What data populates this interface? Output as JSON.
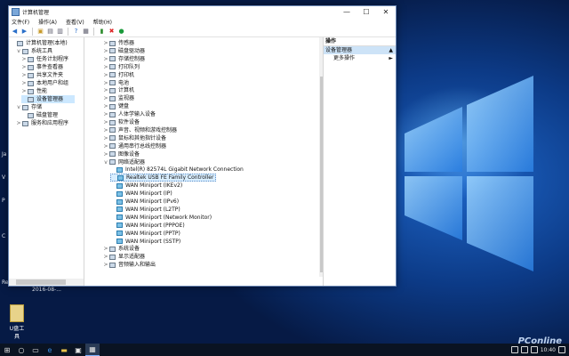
{
  "window": {
    "title": "计算机管理",
    "controls": {
      "minimize": "—",
      "maximize": "☐",
      "close": "✕"
    },
    "menu": [
      "文件(F)",
      "操作(A)",
      "查看(V)",
      "帮助(H)"
    ]
  },
  "left_tree": {
    "items": [
      {
        "label": "计算机管理(本地)",
        "depth": 0,
        "chev": ""
      },
      {
        "label": "系统工具",
        "depth": 1,
        "chev": "v"
      },
      {
        "label": "任务计划程序",
        "depth": 2,
        "chev": ">"
      },
      {
        "label": "事件查看器",
        "depth": 2,
        "chev": ">"
      },
      {
        "label": "共享文件夹",
        "depth": 2,
        "chev": ">"
      },
      {
        "label": "本地用户和组",
        "depth": 2,
        "chev": ">"
      },
      {
        "label": "性能",
        "depth": 2,
        "chev": ">"
      },
      {
        "label": "设备管理器",
        "depth": 2,
        "chev": "",
        "selected": true
      },
      {
        "label": "存储",
        "depth": 1,
        "chev": "v"
      },
      {
        "label": "磁盘管理",
        "depth": 2,
        "chev": ""
      },
      {
        "label": "服务和应用程序",
        "depth": 1,
        "chev": ">"
      }
    ]
  },
  "device_tree": {
    "items": [
      {
        "label": "传感器",
        "depth": 1,
        "chev": ">"
      },
      {
        "label": "磁盘驱动器",
        "depth": 1,
        "chev": ">"
      },
      {
        "label": "存储控制器",
        "depth": 1,
        "chev": ">"
      },
      {
        "label": "打印队列",
        "depth": 1,
        "chev": ">"
      },
      {
        "label": "打印机",
        "depth": 1,
        "chev": ">"
      },
      {
        "label": "电池",
        "depth": 1,
        "chev": ">"
      },
      {
        "label": "计算机",
        "depth": 1,
        "chev": ">"
      },
      {
        "label": "监视器",
        "depth": 1,
        "chev": ">"
      },
      {
        "label": "键盘",
        "depth": 1,
        "chev": ">"
      },
      {
        "label": "人体学输入设备",
        "depth": 1,
        "chev": ">"
      },
      {
        "label": "软件设备",
        "depth": 1,
        "chev": ">"
      },
      {
        "label": "声音、视频和游戏控制器",
        "depth": 1,
        "chev": ">"
      },
      {
        "label": "鼠标和其他指针设备",
        "depth": 1,
        "chev": ">"
      },
      {
        "label": "通用串行总线控制器",
        "depth": 1,
        "chev": ">"
      },
      {
        "label": "图像设备",
        "depth": 1,
        "chev": ">"
      },
      {
        "label": "网络适配器",
        "depth": 1,
        "chev": "v"
      },
      {
        "label": "Intel(R) 82574L Gigabit Network Connection",
        "depth": 2,
        "chev": "",
        "net": true
      },
      {
        "label": "Realtek USB FE Family Controller",
        "depth": 2,
        "chev": "",
        "net": true,
        "selected": true
      },
      {
        "label": "WAN Miniport (IKEv2)",
        "depth": 2,
        "chev": "",
        "net": true
      },
      {
        "label": "WAN Miniport (IP)",
        "depth": 2,
        "chev": "",
        "net": true
      },
      {
        "label": "WAN Miniport (IPv6)",
        "depth": 2,
        "chev": "",
        "net": true
      },
      {
        "label": "WAN Miniport (L2TP)",
        "depth": 2,
        "chev": "",
        "net": true
      },
      {
        "label": "WAN Miniport (Network Monitor)",
        "depth": 2,
        "chev": "",
        "net": true
      },
      {
        "label": "WAN Miniport (PPPOE)",
        "depth": 2,
        "chev": "",
        "net": true
      },
      {
        "label": "WAN Miniport (PPTP)",
        "depth": 2,
        "chev": "",
        "net": true
      },
      {
        "label": "WAN Miniport (SSTP)",
        "depth": 2,
        "chev": "",
        "net": true
      },
      {
        "label": "系统设备",
        "depth": 1,
        "chev": ">"
      },
      {
        "label": "显示适配器",
        "depth": 1,
        "chev": ">"
      },
      {
        "label": "音频输入和输出",
        "depth": 1,
        "chev": ">"
      }
    ]
  },
  "actions_pane": {
    "header": "操作",
    "section": "设备管理器",
    "section_arrow": "▲",
    "more": "更多操作",
    "more_arrow": "►"
  },
  "desktop": {
    "left_labels": [
      "Ja",
      "V",
      "P",
      "C",
      "Re"
    ],
    "date_text": "2016-08-...",
    "icon_label": "U盘工具",
    "watermark": "PConline"
  },
  "taskbar": {
    "time": "10:40"
  }
}
